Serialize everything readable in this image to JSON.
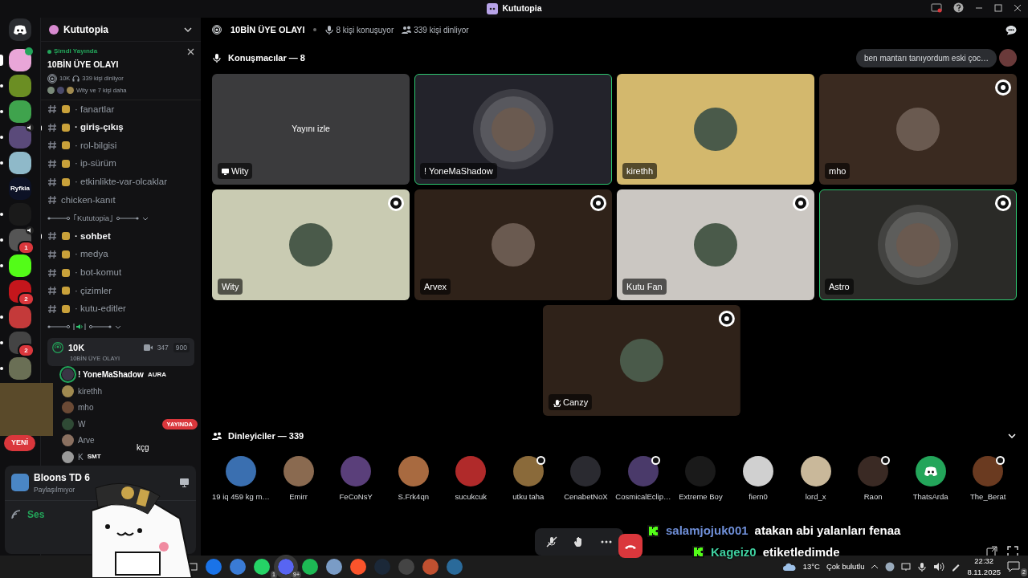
{
  "window": {
    "title": "Kututopia"
  },
  "servers": [
    {
      "kind": "home",
      "selected": false,
      "color": "#2b2d31"
    },
    {
      "kind": "icon",
      "selected": true,
      "color": "#e9a6d8",
      "badge_dot": true
    },
    {
      "kind": "icon",
      "selected": false,
      "color": "#6b8e23",
      "unread": true
    },
    {
      "kind": "icon",
      "selected": false,
      "color": "#3fa34d",
      "unread": true
    },
    {
      "kind": "icon",
      "selected": false,
      "color": "#5a4a7a",
      "unread": true,
      "speaker": true
    },
    {
      "kind": "icon",
      "selected": false,
      "color": "#8fb9c9",
      "unread": true
    },
    {
      "kind": "wordmark",
      "selected": false,
      "color": "#0d1226",
      "label": "Ryfkia"
    },
    {
      "kind": "icon",
      "selected": false,
      "color": "#1a1a1a",
      "unread": true
    },
    {
      "kind": "icon",
      "selected": false,
      "color": "#555555",
      "unread": true,
      "speaker": true,
      "badge": "1"
    },
    {
      "kind": "icon",
      "selected": false,
      "color": "#53fc18",
      "unread": true
    },
    {
      "kind": "icon",
      "selected": false,
      "color": "#c4161c",
      "badge": "2"
    },
    {
      "kind": "icon",
      "selected": false,
      "color": "#c43a3a",
      "unread": true
    },
    {
      "kind": "icon",
      "selected": false,
      "color": "#444444",
      "unread": true,
      "badge": "2"
    },
    {
      "kind": "icon",
      "selected": false,
      "color": "#6a6f55",
      "unread": true
    }
  ],
  "sidebar": {
    "server_name": "Kututopia",
    "live": {
      "status": "Şimdi Yayında",
      "title": "10BİN ÜYE OLAYI",
      "stage": "10K",
      "listeners": "339 kişi dinliyor",
      "participants": "Wity ve 7 kişi daha"
    },
    "channels": [
      {
        "kind": "text",
        "name": "· fanartlar",
        "emoji": true,
        "unread": false
      },
      {
        "kind": "text",
        "name": "· giriş-çıkış",
        "emoji": true,
        "unread": true
      },
      {
        "kind": "text",
        "name": "· rol-bilgisi",
        "emoji": true,
        "unread": false
      },
      {
        "kind": "text",
        "name": "· ip-sürüm",
        "emoji": true,
        "unread": false
      },
      {
        "kind": "text",
        "name": "· etkinlikte-var-olcaklar",
        "emoji": true,
        "unread": false
      },
      {
        "kind": "text",
        "name": "chicken-kanıt",
        "emoji": false,
        "unread": false
      },
      {
        "kind": "category",
        "label": "｢Kututopia｣"
      },
      {
        "kind": "text",
        "name": "· sohbet",
        "emoji": true,
        "unread": true
      },
      {
        "kind": "text",
        "name": "· medya",
        "emoji": true,
        "unread": false
      },
      {
        "kind": "text",
        "name": "· bot-komut",
        "emoji": true,
        "unread": false
      },
      {
        "kind": "text",
        "name": "· çizimler",
        "emoji": true,
        "unread": false
      },
      {
        "kind": "text",
        "name": "· kutu-editler",
        "emoji": true,
        "unread": false
      },
      {
        "kind": "category",
        "speaker": true
      }
    ],
    "voice": {
      "name": "10K",
      "subtitle": "10BİN ÜYE OLAYI",
      "video_count": "347",
      "limit": "900",
      "members": [
        {
          "name": "! YoneMaShadow",
          "tag": "AURA",
          "speaking": true,
          "color": "#3a3545"
        },
        {
          "name": "kirethh",
          "speaking": false,
          "color": "#a08a50"
        },
        {
          "name": "mho",
          "speaking": false,
          "color": "#6b4a35"
        },
        {
          "name": "W",
          "speaking": false,
          "live": "YAYINDA",
          "color": "#2f4a35"
        },
        {
          "name": "Arve",
          "speaking": false,
          "color": "#8a7060"
        },
        {
          "name": "K",
          "speaking": false,
          "tag": "SMT",
          "color": "#9a9a9a"
        }
      ]
    },
    "new_badge": "YENİ",
    "activity": {
      "game": "Bloons TD 6",
      "status": "Paylaşılmıyor"
    },
    "voice_status": "Ses"
  },
  "sticker_caption": "kçg",
  "stage": {
    "title": "10BİN ÜYE OLAYI",
    "speaking": "8 kişi konuşuyor",
    "listening": "339 kişi dinliyor",
    "speakers_heading": "Konuşmacılar — 8",
    "chat_preview": "ben mantarı tanıyordum eski çoc…",
    "tiles": [
      {
        "kind": "stream",
        "name": "Wity",
        "action": "Yayını izle",
        "speaking": false,
        "badge": false,
        "color": "#3b3b3d"
      },
      {
        "kind": "avatar",
        "name": "! YoneMaShadow",
        "speaking": true,
        "badge": false,
        "color": "#23232b",
        "ring": true
      },
      {
        "kind": "avatar",
        "name": "kirethh",
        "speaking": false,
        "badge": false,
        "color": "#d3b86d"
      },
      {
        "kind": "avatar",
        "name": "mho",
        "speaking": false,
        "badge": true,
        "color": "#3a2a20"
      },
      {
        "kind": "avatar",
        "name": "Wity",
        "speaking": false,
        "badge": true,
        "color": "#c9cbb2"
      },
      {
        "kind": "avatar",
        "name": "Arvex",
        "speaking": false,
        "badge": true,
        "color": "#2f2219"
      },
      {
        "kind": "avatar",
        "name": "Kutu Fan",
        "speaking": false,
        "badge": true,
        "color": "#cbc7c2"
      },
      {
        "kind": "avatar",
        "name": "Astro",
        "speaking": true,
        "badge": true,
        "color": "#2a2a27",
        "ring": true
      },
      {
        "kind": "avatar",
        "name": "Canzy",
        "speaking": false,
        "badge": true,
        "color": "#2f2219",
        "muted": true
      }
    ],
    "listeners_heading": "Dinleyiciler — 339",
    "listeners": [
      {
        "name": "19 iq 459 kg m…",
        "color": "#3a6fb0",
        "badge": false
      },
      {
        "name": "Emirr",
        "color": "#8a6a50",
        "badge": false
      },
      {
        "name": "FeCoNsY",
        "color": "#5a3f7a",
        "badge": false
      },
      {
        "name": "S.Frk4qn",
        "color": "#a86a40",
        "badge": false
      },
      {
        "name": "sucukcuk",
        "color": "#b02a2a",
        "badge": false
      },
      {
        "name": "utku taha",
        "color": "#8a6a3a",
        "badge": true
      },
      {
        "name": "CenabetNoX",
        "color": "#2a2a30",
        "badge": false
      },
      {
        "name": "CosmicalEclip…",
        "color": "#4a3a6a",
        "badge": true
      },
      {
        "name": "Extreme Boy",
        "color": "#1a1a1a",
        "badge": false
      },
      {
        "name": "fiern0",
        "color": "#d0d0d0",
        "badge": false
      },
      {
        "name": "lord_x",
        "color": "#c9b89a",
        "badge": false
      },
      {
        "name": "Raon",
        "color": "#3a2a24",
        "badge": true
      },
      {
        "name": "ThatsArda",
        "color": "#23a55a",
        "badge": false,
        "discord": true
      },
      {
        "name": "The_Berat",
        "color": "#6a3a20",
        "badge": true
      }
    ]
  },
  "chat_overlay": [
    {
      "user": "salamjojuk001",
      "text": "atakan abi yalanları fenaa",
      "color": "#6f8fd8"
    },
    {
      "user": "Kageiz0",
      "text": "etiketledimde",
      "color": "#3fd0a0"
    }
  ],
  "taskbar": {
    "apps": [
      {
        "color": "#1a73e8"
      },
      {
        "color": "#3a7bd5"
      },
      {
        "color": "#25d366",
        "badge": "1"
      },
      {
        "color": "#5865f2",
        "badge": "9+",
        "active": true
      },
      {
        "color": "#1db954"
      },
      {
        "color": "#7a9cc6"
      },
      {
        "color": "#fb542b"
      },
      {
        "color": "#1b2838"
      },
      {
        "color": "#444444"
      },
      {
        "color": "#c05030"
      },
      {
        "color": "#2a6a9a"
      }
    ],
    "temperature": "13°C",
    "weather": "Çok bulutlu",
    "time": "22:32",
    "date": "8.11.2025",
    "notifications": "2"
  }
}
